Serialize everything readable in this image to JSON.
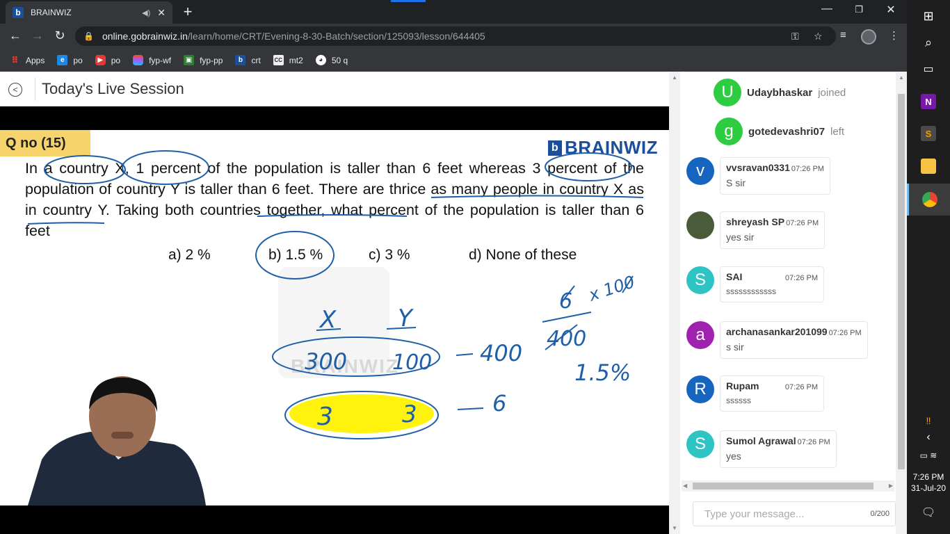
{
  "browser": {
    "tab_title": "BRAINWIZ",
    "tab_favicon": "b",
    "new_tab": "+",
    "url_host": "online.gobrainwiz.in",
    "url_path": "/learn/home/CRT/Evening-8-30-Batch/section/125093/lesson/644405",
    "bookmarks": [
      {
        "label": "Apps",
        "icon": "apps-grid-icon"
      },
      {
        "label": "po",
        "icon": "ie-icon"
      },
      {
        "label": "po",
        "icon": "youtube-icon"
      },
      {
        "label": "fyp-wf",
        "icon": "figma-icon"
      },
      {
        "label": "fyp-pp",
        "icon": "image-icon"
      },
      {
        "label": "crt",
        "icon": "brainwiz-icon"
      },
      {
        "label": "mt2",
        "icon": "cc-icon"
      },
      {
        "label": "50 q",
        "icon": "globe-icon"
      }
    ]
  },
  "session": {
    "title": "Today's Live Session"
  },
  "slide": {
    "qno": "Q no (15)",
    "brand": "BRAINWIZ",
    "question_text": "In a country X, 1 percent of the population is taller than 6 feet whereas 3 percent of the population of country Y is taller than 6 feet. There are thrice as many people in country X as in country Y. Taking both countries together, what percent of the population is taller than 6 feet",
    "options": [
      "a) 2 %",
      "b) 1.5 %",
      "c) 3 %",
      "d) None of these"
    ],
    "watermark": "BRAINWIZ",
    "ink": {
      "x_label": "X",
      "y_label": "Y",
      "x_pop": "300",
      "y_pop": "100",
      "total_pop": "400",
      "x_tall": "3",
      "y_tall": "3",
      "total_tall": "6",
      "frac_num": "6",
      "frac_den": "400",
      "times": "x 100",
      "result": "1.5%"
    },
    "highlight_color": "#fff200",
    "ink_color": "#1f5fa8"
  },
  "chat": {
    "events": [
      {
        "initial": "U",
        "name": "Udaybhaskar",
        "event": "joined",
        "color": "#2ecc40"
      },
      {
        "initial": "g",
        "name": "gotedevashri07",
        "event": "left",
        "color": "#2ecc40"
      }
    ],
    "messages": [
      {
        "initial": "v",
        "sender": "vvsravan0331",
        "time": "07:26 PM",
        "text": "S sir",
        "color": "#1565c0"
      },
      {
        "initial": "",
        "sender": "shreyash SP",
        "time": "07:26 PM",
        "text": "yes sir",
        "color": "#4a5b3a"
      },
      {
        "initial": "S",
        "sender": "SAI",
        "time": "07:26 PM",
        "text": "ssssssssssss",
        "color": "#2ec4c4"
      },
      {
        "initial": "a",
        "sender": "archanasankar201099",
        "time": "07:26 PM",
        "text": "s sir",
        "color": "#a020b0"
      },
      {
        "initial": "R",
        "sender": "Rupam",
        "time": "07:26 PM",
        "text": "ssssss",
        "color": "#1565c0"
      },
      {
        "initial": "S",
        "sender": "Sumol Agrawal",
        "time": "07:26 PM",
        "text": "yes",
        "color": "#2ec4c4"
      }
    ],
    "input_placeholder": "Type your message...",
    "char_count": "0/200"
  },
  "taskbar": {
    "time": "7:26 PM",
    "date": "31-Jul-20",
    "items": [
      "windows-start-icon",
      "search-icon",
      "task-view-icon",
      "onenote-icon",
      "sublime-icon",
      "file-explorer-icon",
      "chrome-icon"
    ]
  }
}
